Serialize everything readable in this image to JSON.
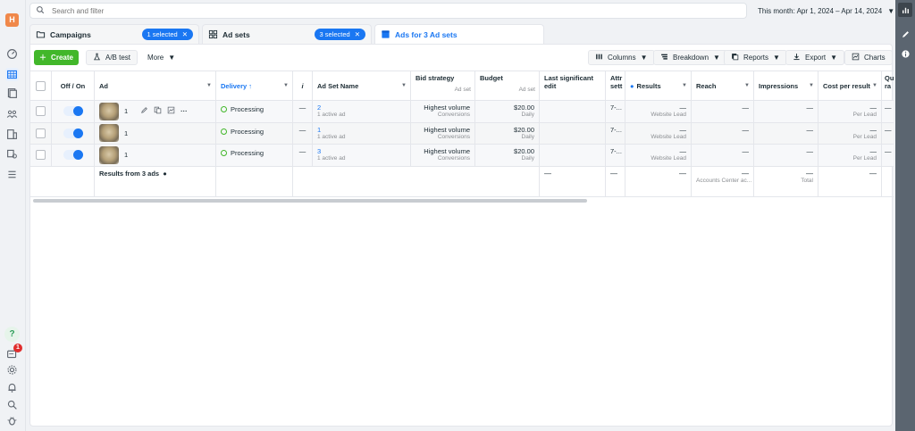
{
  "brand": {
    "logo_letter": "H",
    "accent": "#1a77f2",
    "create_green": "#42b72a"
  },
  "left_rail": {
    "icons": [
      "dashboard-icon",
      "table-icon",
      "pages-icon",
      "people-icon",
      "billing-icon",
      "catalog-icon",
      "menu-icon"
    ],
    "help_label": "?",
    "notification_count": "1",
    "bottom_icons": [
      "notifications-list-icon",
      "settings-icon",
      "bell-icon",
      "search-icon",
      "bug-icon"
    ]
  },
  "right_rail": {
    "icons": [
      "chart-icon",
      "edit-icon",
      "info-icon"
    ]
  },
  "search": {
    "placeholder": "Search and filter"
  },
  "date_range": {
    "label": "This month: Apr 1, 2024 – Apr 14, 2024"
  },
  "tabs": [
    {
      "label": "Campaigns",
      "pill": "1 selected"
    },
    {
      "label": "Ad sets",
      "pill": "3 selected"
    },
    {
      "label": "Ads for 3 Ad sets"
    }
  ],
  "toolbar": {
    "create": "Create",
    "ab_test": "A/B test",
    "more": "More",
    "columns": "Columns",
    "breakdown": "Breakdown",
    "reports": "Reports",
    "export": "Export",
    "charts": "Charts"
  },
  "columns": {
    "off_on": "Off / On",
    "ad": "Ad",
    "delivery": "Delivery",
    "i": "i",
    "ad_set_name": "Ad Set Name",
    "bid_strategy": "Bid strategy",
    "bid_strategy_sub": "Ad set",
    "budget": "Budget",
    "budget_sub": "Ad set",
    "last_edit": "Last significant edit",
    "attribution": "Attr sett",
    "results": "Results",
    "reach": "Reach",
    "impressions": "Impressions",
    "cost_per_result": "Cost per result",
    "quality": "Qu ra",
    "quality_sub": "Ad"
  },
  "rows": [
    {
      "ad_label": "1",
      "delivery": "Processing",
      "i": "—",
      "ad_set": "2",
      "ad_set_sub": "1 active ad",
      "bid": "Highest volume",
      "bid_sub": "Conversions",
      "budget": "$20.00",
      "budget_sub": "Daily",
      "attr": "7-...",
      "results": "—",
      "results_sub": "Website Lead",
      "reach": "—",
      "impressions": "—",
      "cpr": "—",
      "cpr_sub": "Per Lead",
      "quality": "—"
    },
    {
      "ad_label": "1",
      "delivery": "Processing",
      "i": "—",
      "ad_set": "1",
      "ad_set_sub": "1 active ad",
      "bid": "Highest volume",
      "bid_sub": "Conversions",
      "budget": "$20.00",
      "budget_sub": "Daily",
      "attr": "7-...",
      "results": "—",
      "results_sub": "Website Lead",
      "reach": "—",
      "impressions": "—",
      "cpr": "—",
      "cpr_sub": "Per Lead",
      "quality": "—"
    },
    {
      "ad_label": "1",
      "delivery": "Processing",
      "i": "—",
      "ad_set": "3",
      "ad_set_sub": "1 active ad",
      "bid": "Highest volume",
      "bid_sub": "Conversions",
      "budget": "$20.00",
      "budget_sub": "Daily",
      "attr": "7-...",
      "results": "—",
      "results_sub": "Website Lead",
      "reach": "—",
      "impressions": "—",
      "cpr": "—",
      "cpr_sub": "Per Lead",
      "quality": "—"
    }
  ],
  "summary": {
    "label": "Results from 3 ads",
    "last_edit": "—",
    "attr": "—",
    "results": "—",
    "reach": "—",
    "reach_sub": "Accounts Center ac...",
    "impressions": "—",
    "impressions_sub": "Total",
    "cpr": "—"
  }
}
